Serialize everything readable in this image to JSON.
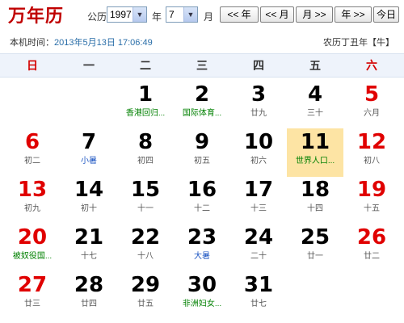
{
  "header": {
    "title": "万年历",
    "year_label": "公历",
    "year_value": "1997",
    "year_suffix": "年",
    "month_value": "7",
    "month_suffix": "月",
    "nav_prev_year": "<< 年",
    "nav_prev_month": "<< 月",
    "nav_next_month": "月 >>",
    "nav_next_year": "年 >>",
    "today_button": "今日",
    "now_label": "本机时间：",
    "now_value": "2013年5月13日 17:06:49",
    "lunar_year": "农历丁丑年【牛】"
  },
  "weekdays": [
    "日",
    "一",
    "二",
    "三",
    "四",
    "五",
    "六"
  ],
  "days": [
    {
      "d": "",
      "sub": ""
    },
    {
      "d": "",
      "sub": ""
    },
    {
      "d": "1",
      "sub": "香港回归...",
      "style": "green"
    },
    {
      "d": "2",
      "sub": "国际体育...",
      "style": "green"
    },
    {
      "d": "3",
      "sub": "廿九"
    },
    {
      "d": "4",
      "sub": "三十"
    },
    {
      "d": "5",
      "sub": "六月"
    },
    {
      "d": "6",
      "sub": "初二"
    },
    {
      "d": "7",
      "sub": "小暑",
      "style": "blue"
    },
    {
      "d": "8",
      "sub": "初四"
    },
    {
      "d": "9",
      "sub": "初五"
    },
    {
      "d": "10",
      "sub": "初六"
    },
    {
      "d": "11",
      "sub": "世界人口...",
      "style": "green",
      "today": true
    },
    {
      "d": "12",
      "sub": "初八"
    },
    {
      "d": "13",
      "sub": "初九"
    },
    {
      "d": "14",
      "sub": "初十"
    },
    {
      "d": "15",
      "sub": "十一"
    },
    {
      "d": "16",
      "sub": "十二"
    },
    {
      "d": "17",
      "sub": "十三"
    },
    {
      "d": "18",
      "sub": "十四"
    },
    {
      "d": "19",
      "sub": "十五"
    },
    {
      "d": "20",
      "sub": "被奴役国...",
      "style": "green"
    },
    {
      "d": "21",
      "sub": "十七"
    },
    {
      "d": "22",
      "sub": "十八"
    },
    {
      "d": "23",
      "sub": "大暑",
      "style": "blue"
    },
    {
      "d": "24",
      "sub": "二十"
    },
    {
      "d": "25",
      "sub": "廿一"
    },
    {
      "d": "26",
      "sub": "廿二"
    },
    {
      "d": "27",
      "sub": "廿三"
    },
    {
      "d": "28",
      "sub": "廿四"
    },
    {
      "d": "29",
      "sub": "廿五"
    },
    {
      "d": "30",
      "sub": "非洲妇女...",
      "style": "green"
    },
    {
      "d": "31",
      "sub": "廿七"
    }
  ]
}
